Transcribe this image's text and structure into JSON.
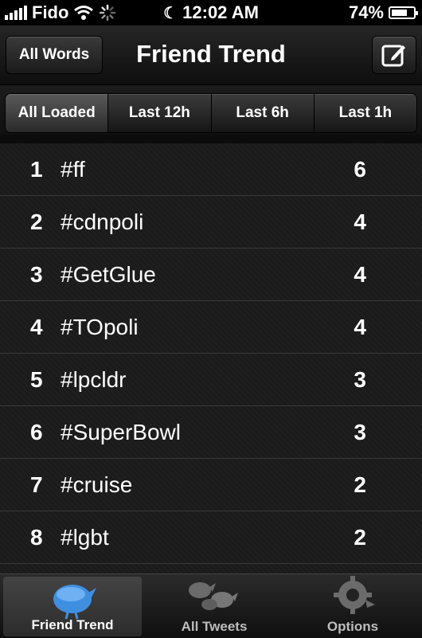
{
  "status_bar": {
    "carrier": "Fido",
    "time": "12:02 AM",
    "battery": "74%",
    "battery_level": 0.74
  },
  "navbar": {
    "left_button": "All Words",
    "title": "Friend Trend",
    "right_icon": "compose-icon"
  },
  "segments": [
    {
      "label": "All Loaded",
      "selected": true
    },
    {
      "label": "Last 12h",
      "selected": false
    },
    {
      "label": "Last 6h",
      "selected": false
    },
    {
      "label": "Last 1h",
      "selected": false
    }
  ],
  "trends": [
    {
      "rank": "1",
      "tag": "#ff",
      "count": "6"
    },
    {
      "rank": "2",
      "tag": "#cdnpoli",
      "count": "4"
    },
    {
      "rank": "3",
      "tag": "#GetGlue",
      "count": "4"
    },
    {
      "rank": "4",
      "tag": "#TOpoli",
      "count": "4"
    },
    {
      "rank": "5",
      "tag": "#lpcldr",
      "count": "3"
    },
    {
      "rank": "6",
      "tag": "#SuperBowl",
      "count": "3"
    },
    {
      "rank": "7",
      "tag": "#cruise",
      "count": "2"
    },
    {
      "rank": "8",
      "tag": "#lgbt",
      "count": "2"
    }
  ],
  "tabs": [
    {
      "label": "Friend Trend",
      "icon": "bird-icon",
      "active": true
    },
    {
      "label": "All Tweets",
      "icon": "birds-icon",
      "active": false
    },
    {
      "label": "Options",
      "icon": "gear-bird-icon",
      "active": false
    }
  ],
  "colors": {
    "tab_active_icon": "#3f8fe0",
    "tab_inactive_icon": "#6b6b6b"
  }
}
